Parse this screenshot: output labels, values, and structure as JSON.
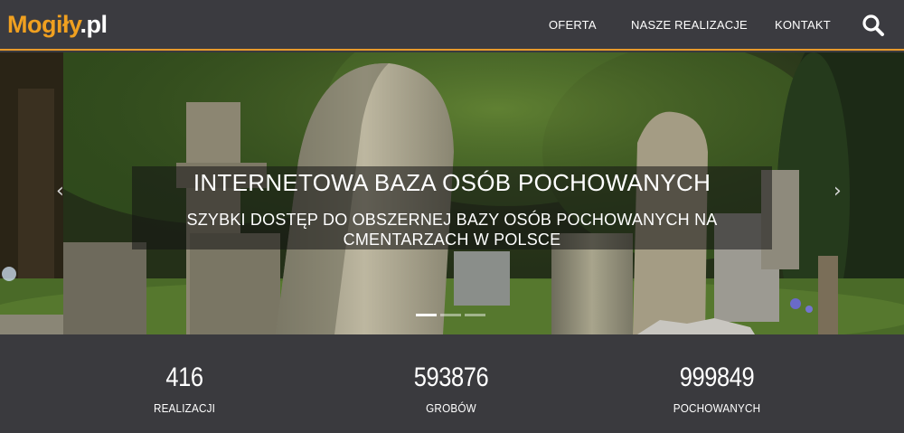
{
  "logo": {
    "brand": "Mogiły",
    "tld": ".pl"
  },
  "nav": {
    "items": [
      {
        "label": "OFERTA"
      },
      {
        "label": "NASZE REALIZACJE"
      },
      {
        "label": "KONTAKT"
      }
    ],
    "search_icon": "search-icon"
  },
  "colors": {
    "accent": "#e89a2c",
    "navbar_bg": "#3b3b40",
    "stats_bg": "#3a3a3e"
  },
  "hero": {
    "title": "INTERNETOWA BAZA OSÓB POCHOWANYCH",
    "subtitle": "SZYBKI DOSTĘP DO OBSZERNEJ BAZY OSÓB POCHOWANYCH NA CMENTARZACH W POLSCE",
    "prev_icon": "chevron-left-icon",
    "next_icon": "chevron-right-icon",
    "slides": 3,
    "active_slide": 1
  },
  "stats": [
    {
      "number": "416",
      "label": "REALIZACJI"
    },
    {
      "number": "593876",
      "label": "GROBÓW"
    },
    {
      "number": "999849",
      "label": "POCHOWANYCH"
    }
  ]
}
